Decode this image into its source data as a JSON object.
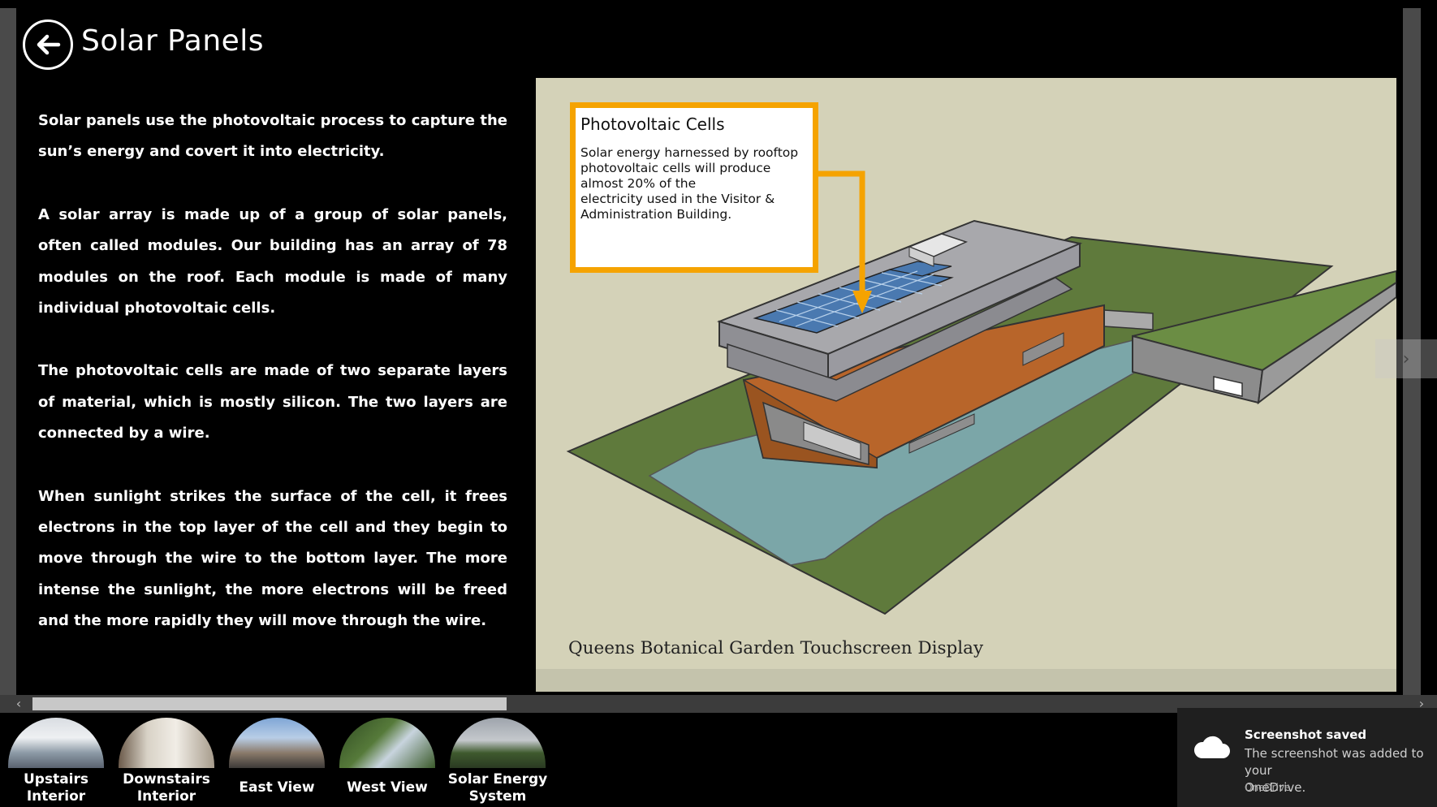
{
  "header": {
    "back_icon": "arrow-left-icon",
    "title": "Solar Panels"
  },
  "article": {
    "paragraphs": [
      "Solar panels use the photovoltaic process to capture the sun’s energy and covert it into electricity.",
      "A solar array is made up of a group of solar panels, often called modules.  Our building has an array of 78 modules on the roof.  Each module is made of many individual photovoltaic cells.",
      "The photovoltaic cells are made of two separate layers of material, which is mostly silicon.  The two layers are connected by a wire.",
      "When sunlight strikes the surface of the cell, it frees electrons in the top layer of the cell and they begin to move through the wire to the bottom layer.  The more intense the sunlight, the more electrons will be freed and the more rapidly they will move through the wire."
    ]
  },
  "figure": {
    "callout_title": "Photovoltaic Cells",
    "callout_body": "Solar energy harnessed by rooftop\nphotovoltaic cells will produce\nalmost 20% of the\nelectricity used in the Visitor &\nAdministration Building.",
    "caption": "Queens Botanical Garden Touchscreen Display",
    "next_icon": "chevron-right-icon",
    "colors": {
      "callout_border": "#f5a300",
      "background": "#d4d2b8"
    }
  },
  "scrollbar": {
    "left_icon": "chevron-left-icon",
    "right_icon": "chevron-right-icon",
    "left_glyph": "‹",
    "right_glyph": "›",
    "next_glyph": "›"
  },
  "thumbnails": [
    {
      "label": "Upstairs\nInterior"
    },
    {
      "label": "Downstairs\nInterior"
    },
    {
      "label": "East View"
    },
    {
      "label": "West View"
    },
    {
      "label": "Solar Energy\nSystem"
    }
  ],
  "toast": {
    "icon": "cloud-icon",
    "title": "Screenshot saved",
    "body": "The screenshot was added to your\nOneDrive.",
    "app": "OneDrive"
  }
}
